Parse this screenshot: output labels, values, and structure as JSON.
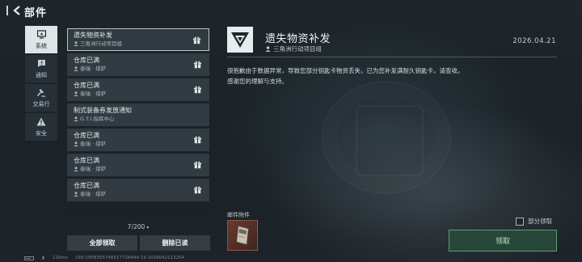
{
  "header": {
    "title": "部件"
  },
  "sidebar": {
    "items": [
      {
        "label": "系统",
        "icon": "system-icon",
        "active": true
      },
      {
        "label": "通知",
        "icon": "notice-icon",
        "active": false
      },
      {
        "label": "交易行",
        "icon": "hammer-icon",
        "active": false
      },
      {
        "label": "安全",
        "icon": "warning-icon",
        "active": false
      }
    ]
  },
  "mail_list": {
    "items": [
      {
        "title": "遗失物资补发",
        "sender": "三角洲行动项目组",
        "selected": true
      },
      {
        "title": "仓库已满",
        "sender": "泰瑞 · 缪萨",
        "selected": false
      },
      {
        "title": "仓库已满",
        "sender": "泰瑞 · 缪萨",
        "selected": false
      },
      {
        "title": "制式装备券发放通知",
        "sender": "G.T.I.指挥中心",
        "selected": false
      },
      {
        "title": "仓库已满",
        "sender": "泰瑞 · 缪萨",
        "selected": false
      },
      {
        "title": "仓库已满",
        "sender": "泰瑞 · 缪萨",
        "selected": false
      },
      {
        "title": "仓库已满",
        "sender": "泰瑞 · 缪萨",
        "selected": false
      }
    ],
    "count": "7/200",
    "claim_all_label": "全部领取",
    "delete_read_label": "删除已读"
  },
  "detail": {
    "title": "遗失物资补发",
    "sender": "三角洲行动项目组",
    "date": "2026.04.21",
    "body_line1": "很抱歉由于数据异常，导致您部分钥匙卡物资丢失，已为您补发满耐久钥匙卡，请查收。",
    "body_line2": "感谢您的理解与支持。",
    "attachments_label": "邮件附件",
    "partial_claim_label": "部分领取",
    "claim_label": "领取"
  },
  "footer": {
    "ping": "116ms",
    "uid": "UID:1858355746517728444:19 2026042113254"
  },
  "colors": {
    "background": "#1b2328",
    "accent_green": "#5f9a7a",
    "selected_border": "#b9c3c8"
  }
}
